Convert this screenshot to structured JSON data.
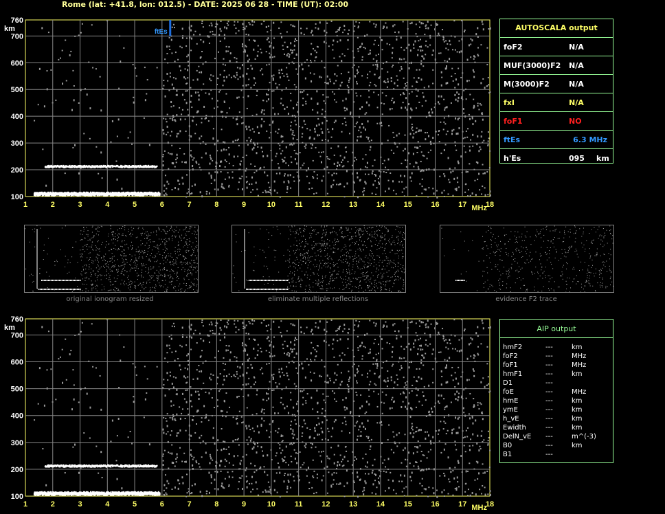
{
  "header": {
    "title": "Rome (lat: +41.8, lon: 012.5) - DATE: 2025 06 28 - TIME (UT): 02:00"
  },
  "colors": {
    "axis": "#ffff66",
    "grid": "#888888",
    "trace": "#ffffff",
    "noise": "#9a9a9a",
    "ftes_marker": "#1e6fe0",
    "box_border": "#99ff99"
  },
  "chart_data": [
    {
      "type": "scatter",
      "name": "ionogram-top",
      "xlabel": "MHz",
      "ylabel": "km",
      "xlim": [
        1,
        18
      ],
      "ylim": [
        100,
        760
      ],
      "xticks": [
        1,
        2,
        3,
        4,
        5,
        6,
        7,
        8,
        9,
        10,
        11,
        12,
        13,
        14,
        15,
        16,
        17,
        18
      ],
      "yticks": [
        100,
        200,
        300,
        400,
        500,
        600,
        700,
        760
      ],
      "grid": true,
      "traces": [
        {
          "name": "E-layer trace",
          "x_start": 1.3,
          "x_end": 5.9,
          "y": 112
        },
        {
          "name": "second reflection trace",
          "x_start": 1.7,
          "x_end": 5.8,
          "y": 212
        }
      ],
      "markers": [
        {
          "label": "ftEs",
          "x": 6.3,
          "y_min": 700,
          "y_max": 760
        }
      ]
    },
    {
      "type": "scatter",
      "name": "ionogram-bottom",
      "xlabel": "MHz",
      "ylabel": "km",
      "xlim": [
        1,
        18
      ],
      "ylim": [
        100,
        760
      ],
      "xticks": [
        1,
        2,
        3,
        4,
        5,
        6,
        7,
        8,
        9,
        10,
        11,
        12,
        13,
        14,
        15,
        16,
        17,
        18
      ],
      "yticks": [
        100,
        200,
        300,
        400,
        500,
        600,
        700,
        760
      ],
      "grid": true,
      "traces": [
        {
          "name": "E-layer trace",
          "x_start": 1.3,
          "x_end": 5.9,
          "y": 112
        },
        {
          "name": "second reflection trace",
          "x_start": 1.7,
          "x_end": 5.8,
          "y": 212
        }
      ],
      "markers": []
    }
  ],
  "autoscala": {
    "title": "AUTOSCALA output",
    "rows": [
      {
        "label": "foF2",
        "value": "N/A",
        "unit": "",
        "color": "#ffffff",
        "label_color": "#ffffff"
      },
      {
        "label": "MUF(3000)F2",
        "value": "N/A",
        "unit": "",
        "color": "#ffffff",
        "label_color": "#ffffff"
      },
      {
        "label": "M(3000)F2",
        "value": "N/A",
        "unit": "",
        "color": "#ffffff",
        "label_color": "#ffffff"
      },
      {
        "label": "fxI",
        "value": "N/A",
        "unit": "",
        "color": "#ffff66",
        "label_color": "#ffff66"
      },
      {
        "label": "foF1",
        "value": "NO",
        "unit": "",
        "color": "#ff2020",
        "label_color": "#ff2020"
      },
      {
        "label": "ftEs",
        "value": "6.3 MHz",
        "unit": "",
        "color": "#3399ff",
        "label_color": "#3399ff"
      },
      {
        "label": "h'Es",
        "value": "095",
        "unit": "km",
        "color": "#ffffff",
        "label_color": "#ffffff"
      }
    ]
  },
  "thumbnails": [
    {
      "caption": "original ionogram resized"
    },
    {
      "caption": "eliminate multiple reflections"
    },
    {
      "caption": "evidence F2 trace"
    }
  ],
  "aip": {
    "title": "AIP output",
    "rows": [
      {
        "k": "hmF2",
        "v": "---",
        "u": "km"
      },
      {
        "k": "foF2",
        "v": "---",
        "u": "MHz"
      },
      {
        "k": "foF1",
        "v": "---",
        "u": "MHz"
      },
      {
        "k": "hmF1",
        "v": "---",
        "u": "km"
      },
      {
        "k": "D1",
        "v": "---",
        "u": ""
      },
      {
        "k": "foE",
        "v": "---",
        "u": "MHz"
      },
      {
        "k": "hmE",
        "v": "---",
        "u": "km"
      },
      {
        "k": "ymE",
        "v": "---",
        "u": "km"
      },
      {
        "k": "h_vE",
        "v": "---",
        "u": "km"
      },
      {
        "k": "Ewidth",
        "v": "---",
        "u": "km"
      },
      {
        "k": "DelN_vE",
        "v": "---",
        "u": "m^(-3)"
      },
      {
        "k": "B0",
        "v": "---",
        "u": "km"
      },
      {
        "k": "B1",
        "v": "---",
        "u": ""
      }
    ]
  }
}
